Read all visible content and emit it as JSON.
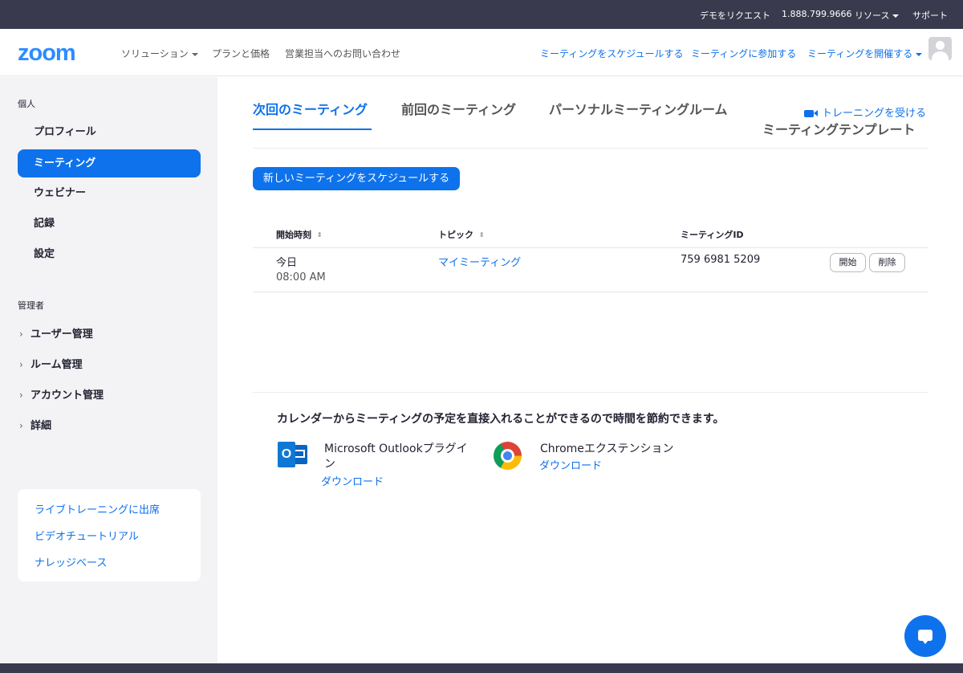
{
  "topbar": {
    "demo": "デモをリクエスト",
    "phone": "1.888.799.9666",
    "resources": "リソース",
    "support": "サポート"
  },
  "header": {
    "logo": "zoom",
    "nav": {
      "solutions": "ソリューション",
      "plans": "プランと価格",
      "sales": "営業担当へのお問い合わせ"
    },
    "links": {
      "schedule": "ミーティングをスケジュールする",
      "join": "ミーティングに参加する",
      "host": "ミーティングを開催する"
    }
  },
  "sidebar": {
    "personal_title": "個人",
    "items": [
      {
        "label": "プロフィール"
      },
      {
        "label": "ミーティング"
      },
      {
        "label": "ウェビナー"
      },
      {
        "label": "記録"
      },
      {
        "label": "設定"
      }
    ],
    "admin_title": "管理者",
    "admin_items": [
      {
        "label": "ユーザー管理"
      },
      {
        "label": "ルーム管理"
      },
      {
        "label": "アカウント管理"
      },
      {
        "label": "詳細"
      }
    ],
    "help_links": [
      {
        "label": "ライブトレーニングに出席"
      },
      {
        "label": "ビデオチュートリアル"
      },
      {
        "label": "ナレッジベース"
      }
    ]
  },
  "main": {
    "tabs": [
      {
        "label": "次回のミーティング"
      },
      {
        "label": "前回のミーティング"
      },
      {
        "label": "パーソナルミーティングルーム"
      }
    ],
    "training_link": "トレーニングを受ける",
    "template_tab": "ミーティングテンプレート",
    "schedule_button": "新しいミーティングをスケジュールする",
    "table": {
      "headers": {
        "start_time": "開始時刻",
        "topic": "トピック",
        "meeting_id": "ミーティングID"
      },
      "rows": [
        {
          "date": "今日",
          "time": "08:00 AM",
          "topic": "マイミーティング",
          "meeting_id": "759 6981 5209",
          "start_btn": "開始",
          "delete_btn": "削除"
        }
      ]
    },
    "calendar": {
      "title": "カレンダーからミーティングの予定を直接入れることができるので時間を節約できます。",
      "outlook_name": "Microsoft Outlookプラグイン",
      "outlook_download": "ダウンロード",
      "chrome_name": "Chromeエクステンション",
      "chrome_download": "ダウンロード"
    }
  },
  "colors": {
    "accent": "#0e72ed",
    "topbar": "#3a3a4f",
    "sidebar_bg": "#f3f3f5"
  }
}
